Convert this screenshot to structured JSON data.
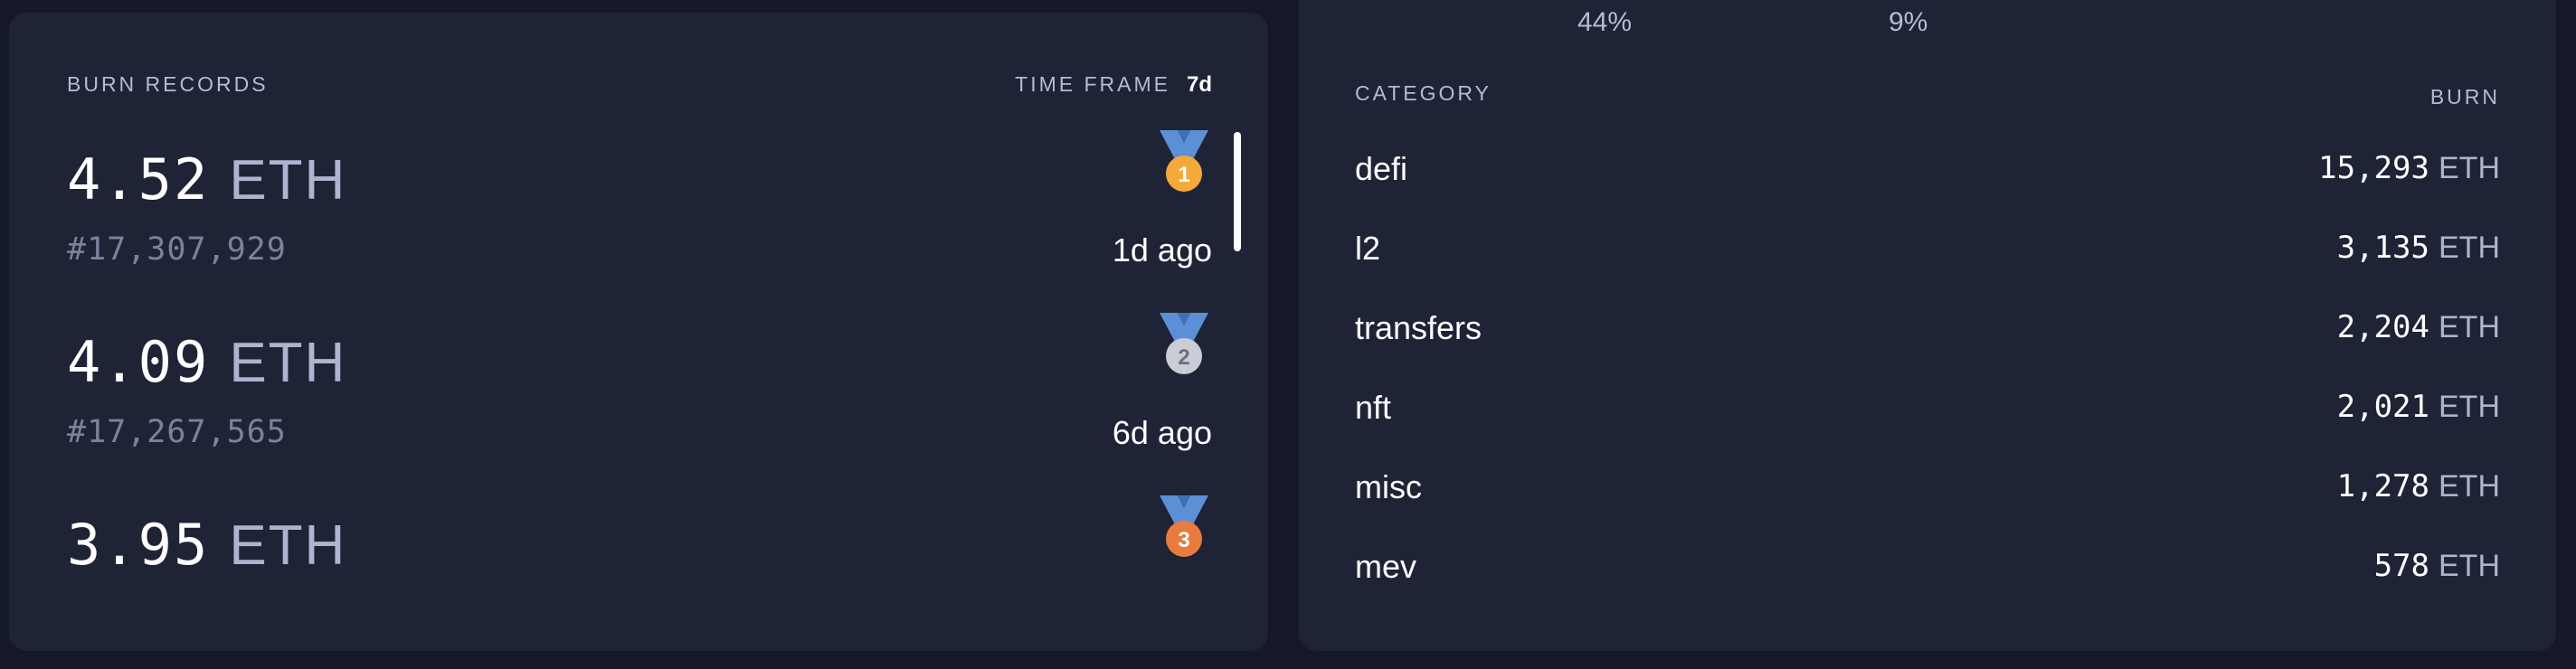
{
  "burn_records": {
    "title": "BURN RECORDS",
    "time_frame_label": "TIME FRAME",
    "time_frame_value": "7d",
    "records": [
      {
        "amount": "4.52",
        "unit": "ETH",
        "block": "#17,307,929",
        "ago": "1d ago",
        "rank": "1",
        "medal": "gold-medal-icon",
        "medal_color": "#f4a93b"
      },
      {
        "amount": "4.09",
        "unit": "ETH",
        "block": "#17,267,565",
        "ago": "6d ago",
        "rank": "2",
        "medal": "silver-medal-icon",
        "medal_color": "#c9cdd6"
      },
      {
        "amount": "3.95",
        "unit": "ETH",
        "block": "",
        "ago": "",
        "rank": "3",
        "medal": "bronze-medal-icon",
        "medal_color": "#e77c3c"
      }
    ]
  },
  "categories": {
    "percentages": [
      "44%",
      "9%"
    ],
    "header_category": "CATEGORY",
    "header_burn": "BURN",
    "rows": [
      {
        "name": "defi",
        "burn": "15,293",
        "unit": "ETH"
      },
      {
        "name": "l2",
        "burn": "3,135",
        "unit": "ETH"
      },
      {
        "name": "transfers",
        "burn": "2,204",
        "unit": "ETH"
      },
      {
        "name": "nft",
        "burn": "2,021",
        "unit": "ETH"
      },
      {
        "name": "misc",
        "burn": "1,278",
        "unit": "ETH"
      },
      {
        "name": "mev",
        "burn": "578",
        "unit": "ETH"
      }
    ]
  },
  "colors": {
    "background": "#151827",
    "panel": "#1f2336",
    "ribbon": "#5b8fd6"
  }
}
